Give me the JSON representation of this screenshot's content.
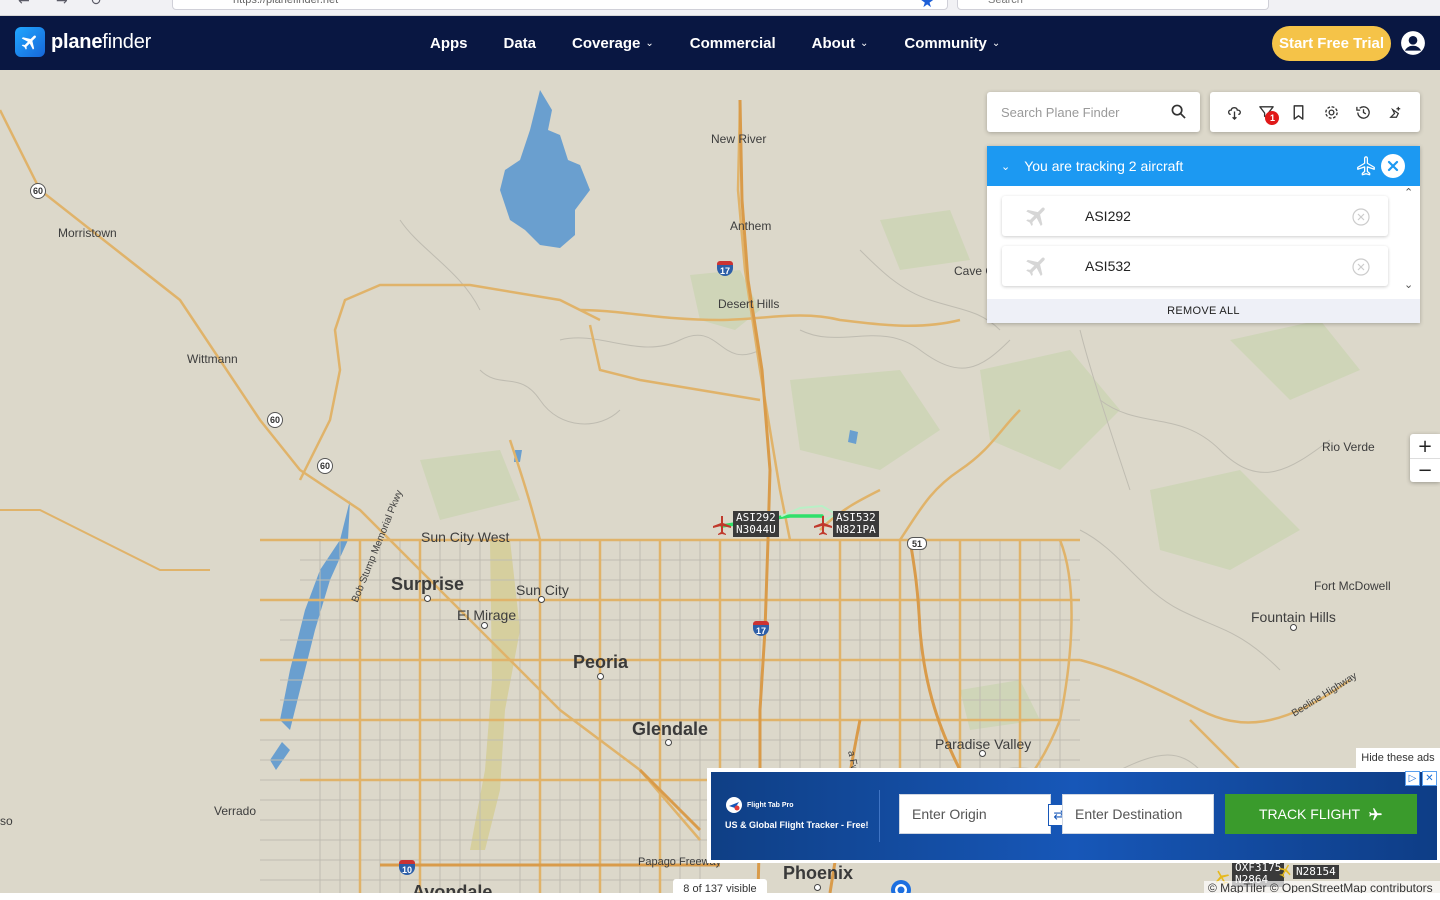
{
  "browser": {
    "url": "https://planefinder.net",
    "search_placeholder": "Search"
  },
  "header": {
    "logo_plane": "plane",
    "logo_finder": "finder",
    "nav": [
      {
        "label": "Apps",
        "dropdown": false
      },
      {
        "label": "Data",
        "dropdown": false
      },
      {
        "label": "Coverage",
        "dropdown": true
      },
      {
        "label": "Commercial",
        "dropdown": false
      },
      {
        "label": "About",
        "dropdown": true
      },
      {
        "label": "Community",
        "dropdown": true
      }
    ],
    "cta": "Start Free Trial",
    "colors": {
      "header_bg": "#091742",
      "cta": "#f5c348",
      "accent": "#1c99f2"
    }
  },
  "search": {
    "placeholder": "Search Plane Finder"
  },
  "toolbar": {
    "buttons": [
      "weather-icon",
      "filter-icon",
      "bookmark-icon",
      "settings-icon",
      "history-icon",
      "playback-icon"
    ],
    "filter_badge": "1"
  },
  "tracking": {
    "title": "You are tracking 2 aircraft",
    "aircraft": [
      {
        "callsign": "ASI292"
      },
      {
        "callsign": "ASI532"
      }
    ],
    "remove_all": "REMOVE ALL"
  },
  "map": {
    "places": {
      "new_river": "New River",
      "anthem": "Anthem",
      "desert_hills": "Desert Hills",
      "cave_creek": "Cave C",
      "morristown": "Morristown",
      "wittmann": "Wittmann",
      "rio_verde": "Rio Verde",
      "sun_city_west": "Sun City West",
      "surprise": "Surprise",
      "sun_city": "Sun City",
      "el_mirage": "El Mirage",
      "peoria": "Peoria",
      "glendale": "Glendale",
      "paradise_valley": "Paradise Valley",
      "fort_mcdowell": "Fort McDowell",
      "fountain_hills": "Fountain Hills",
      "verrado": "Verrado",
      "phoenix": "Phoenix",
      "avondale": "Avondale",
      "edge_so": "so",
      "bob_stump": "Bob Stump Memorial Pkwy",
      "beeline": "Beeline Highway",
      "papago": "Papago Freeway",
      "pima_fwy": "a Fwy"
    },
    "shields": {
      "us60_a": "60",
      "us60_b": "60",
      "us60_c": "60",
      "i17_a": "17",
      "i17_b": "17",
      "i10": "10",
      "sr51": "51"
    },
    "aircraft_labels": [
      {
        "callsign": "ASI292",
        "registration": "N3044U"
      },
      {
        "callsign": "ASI532",
        "registration": "N821PA"
      }
    ],
    "partial_labels": {
      "a": "OXF3175",
      "b": "N2864",
      "c": "N28154"
    },
    "zoom_in": "+",
    "zoom_out": "−"
  },
  "ad": {
    "hide": "Hide these ads",
    "brand": "Flight Tab Pro",
    "tagline": "US & Global Flight Tracker - Free!",
    "origin_placeholder": "Enter Origin",
    "destination_placeholder": "Enter Destination",
    "track": "TRACK FLIGHT"
  },
  "footer": {
    "visible": "8 of 137 visible",
    "attribution": "© MapTiler © OpenStreetMap contributors"
  }
}
